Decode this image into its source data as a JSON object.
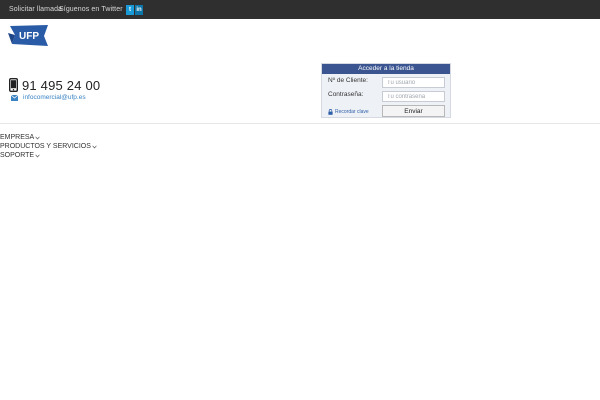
{
  "topbar": {
    "call_label": "Solicitar llamada",
    "twitter_label": "Síguenos en Twitter",
    "social_twitter": "t",
    "social_linkedin": "in"
  },
  "brand": {
    "logo_text": "UFP",
    "logo_color": "#2a5ba6"
  },
  "contact": {
    "phone": "91 495 24 00",
    "email": "infocomercial@ufp.es"
  },
  "login": {
    "title": "Acceder a la tienda",
    "client_label": "Nº de Cliente:",
    "client_placeholder": "Tu usuario",
    "password_label": "Contraseña:",
    "password_placeholder": "Tu contraseña",
    "reminder_label": "Recordar clave",
    "submit_label": "Enviar",
    "header_color": "#3a5590"
  },
  "nav": {
    "items": [
      {
        "label": "EMPRESA"
      },
      {
        "label": "PRODUCTOS Y SERVICIOS"
      },
      {
        "label": "SOPORTE"
      }
    ]
  }
}
